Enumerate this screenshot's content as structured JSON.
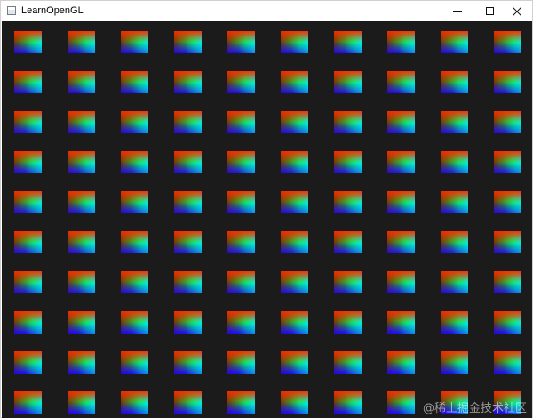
{
  "window": {
    "title": "LearnOpenGL",
    "icon": "app-window-icon",
    "controls": {
      "minimize": "minimize-icon",
      "maximize": "maximize-icon",
      "close": "close-icon"
    }
  },
  "scene": {
    "background_color": "#1b1b1b",
    "grid_columns": 10,
    "grid_rows": 10,
    "quad_colors": {
      "top_left": "#ff2a00",
      "bottom_left": "#2a00ff",
      "right": "#00ff55"
    }
  },
  "watermark": {
    "text": "@稀土掘金技术社区"
  }
}
